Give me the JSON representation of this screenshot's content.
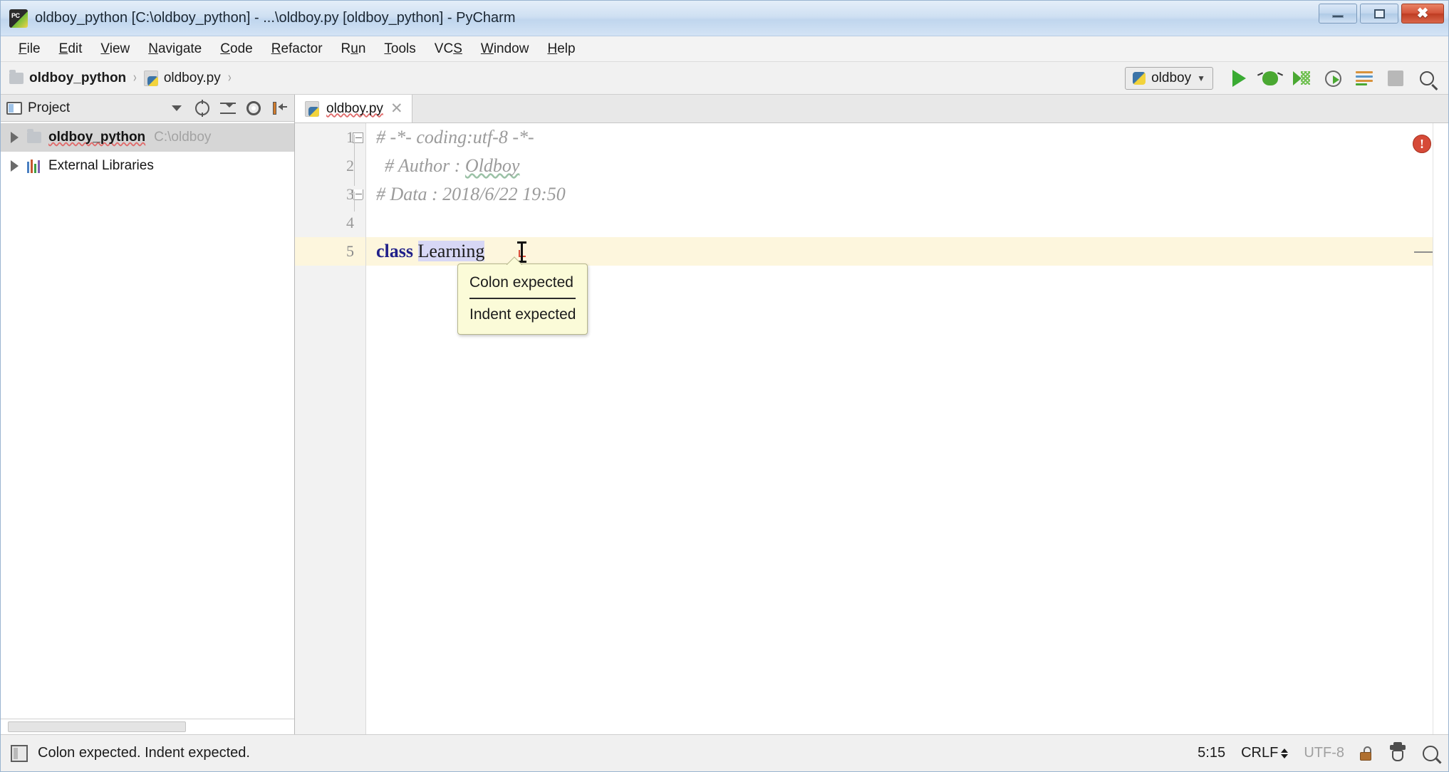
{
  "window": {
    "title": "oldboy_python [C:\\oldboy_python] - ...\\oldboy.py [oldboy_python] - PyCharm",
    "app_icon": "pycharm-icon",
    "minimize_label": "–",
    "maximize_label": "□",
    "close_label": "✕"
  },
  "menubar": {
    "items": [
      {
        "label": "File",
        "mnemonic": "F"
      },
      {
        "label": "Edit",
        "mnemonic": "E"
      },
      {
        "label": "View",
        "mnemonic": "V"
      },
      {
        "label": "Navigate",
        "mnemonic": "N"
      },
      {
        "label": "Code",
        "mnemonic": "C"
      },
      {
        "label": "Refactor",
        "mnemonic": "R"
      },
      {
        "label": "Run",
        "mnemonic": "u"
      },
      {
        "label": "Tools",
        "mnemonic": "T"
      },
      {
        "label": "VCS",
        "mnemonic": "S"
      },
      {
        "label": "Window",
        "mnemonic": "W"
      },
      {
        "label": "Help",
        "mnemonic": "H"
      }
    ]
  },
  "toolbar": {
    "breadcrumb": [
      {
        "label": "oldboy_python",
        "icon": "folder-icon"
      },
      {
        "label": "oldboy.py",
        "icon": "python-file-icon"
      }
    ],
    "separator": "›",
    "run_config": {
      "label": "oldboy",
      "icon": "python-icon",
      "caret": "∨"
    },
    "buttons": [
      {
        "name": "run-button",
        "icon": "play-icon"
      },
      {
        "name": "debug-button",
        "icon": "bug-icon"
      },
      {
        "name": "run-with-coverage-button",
        "icon": "coverage-icon"
      },
      {
        "name": "profile-button",
        "icon": "profiler-icon"
      },
      {
        "name": "run-tests-button",
        "icon": "lines-icon"
      },
      {
        "name": "stop-button",
        "icon": "stop-icon"
      },
      {
        "name": "search-everywhere-button",
        "icon": "search-icon"
      }
    ]
  },
  "project_panel": {
    "header_title": "Project",
    "header_icon": "project-window-icon",
    "tools": [
      {
        "name": "view-mode-dropdown",
        "icon": "chevron-down-icon"
      },
      {
        "name": "scroll-from-source",
        "icon": "target-icon"
      },
      {
        "name": "collapse-all",
        "icon": "collapse-all-icon"
      },
      {
        "name": "settings-gear",
        "icon": "gear-icon"
      },
      {
        "name": "hide-panel",
        "icon": "hide-icon"
      }
    ],
    "tree": [
      {
        "label": "oldboy_python",
        "path": "C:\\oldboy",
        "icon": "folder-icon",
        "expanded": false,
        "selected": true,
        "bold": true
      },
      {
        "label": "External Libraries",
        "path": "",
        "icon": "libraries-icon",
        "expanded": false,
        "selected": false,
        "bold": false
      }
    ]
  },
  "editor": {
    "tabs": [
      {
        "label": "oldboy.py",
        "icon": "python-file-icon",
        "active": true,
        "close": "✕"
      }
    ],
    "lines": [
      {
        "number": "1",
        "segments": [
          {
            "text": "# -*- coding:utf-8 -*-",
            "type": "comment"
          }
        ],
        "fold": "start"
      },
      {
        "number": "2",
        "segments": [
          {
            "text": "# Author : ",
            "type": "comment"
          },
          {
            "text": "Oldboy",
            "type": "comment-spellcheck"
          }
        ],
        "fold": "line"
      },
      {
        "number": "3",
        "segments": [
          {
            "text": "# Data : 2018/6/22 19:50",
            "type": "comment"
          }
        ],
        "fold": "end"
      },
      {
        "number": "4",
        "segments": [],
        "fold": "none"
      },
      {
        "number": "5",
        "segments": [
          {
            "text": "class ",
            "type": "keyword"
          },
          {
            "text": "Learning",
            "type": "identifier-highlight"
          }
        ],
        "fold": "none",
        "current": true
      }
    ],
    "error_marker": {
      "name": "error-indicator",
      "glyph": "!"
    }
  },
  "tooltip": {
    "lines": [
      "Colon expected",
      "Indent expected"
    ]
  },
  "statusbar": {
    "message": "Colon expected. Indent expected.",
    "message_icon": "tool-window-icon",
    "caret_position": "5:15",
    "line_separator": "CRLF",
    "encoding": "UTF-8",
    "lock_icon": "lock-icon",
    "hector_icon": "inspection-hector-icon",
    "search_icon": "search-icon"
  },
  "colors": {
    "accent_blue": "#cfdff0",
    "keyword": "#21218a",
    "comment": "#9b9b9b",
    "identifier_highlight": "#d7d7f5",
    "current_line": "#fdf6dd",
    "tooltip_bg": "#fbfbd8",
    "error_red": "#d64a38",
    "run_green": "#3aab33"
  }
}
